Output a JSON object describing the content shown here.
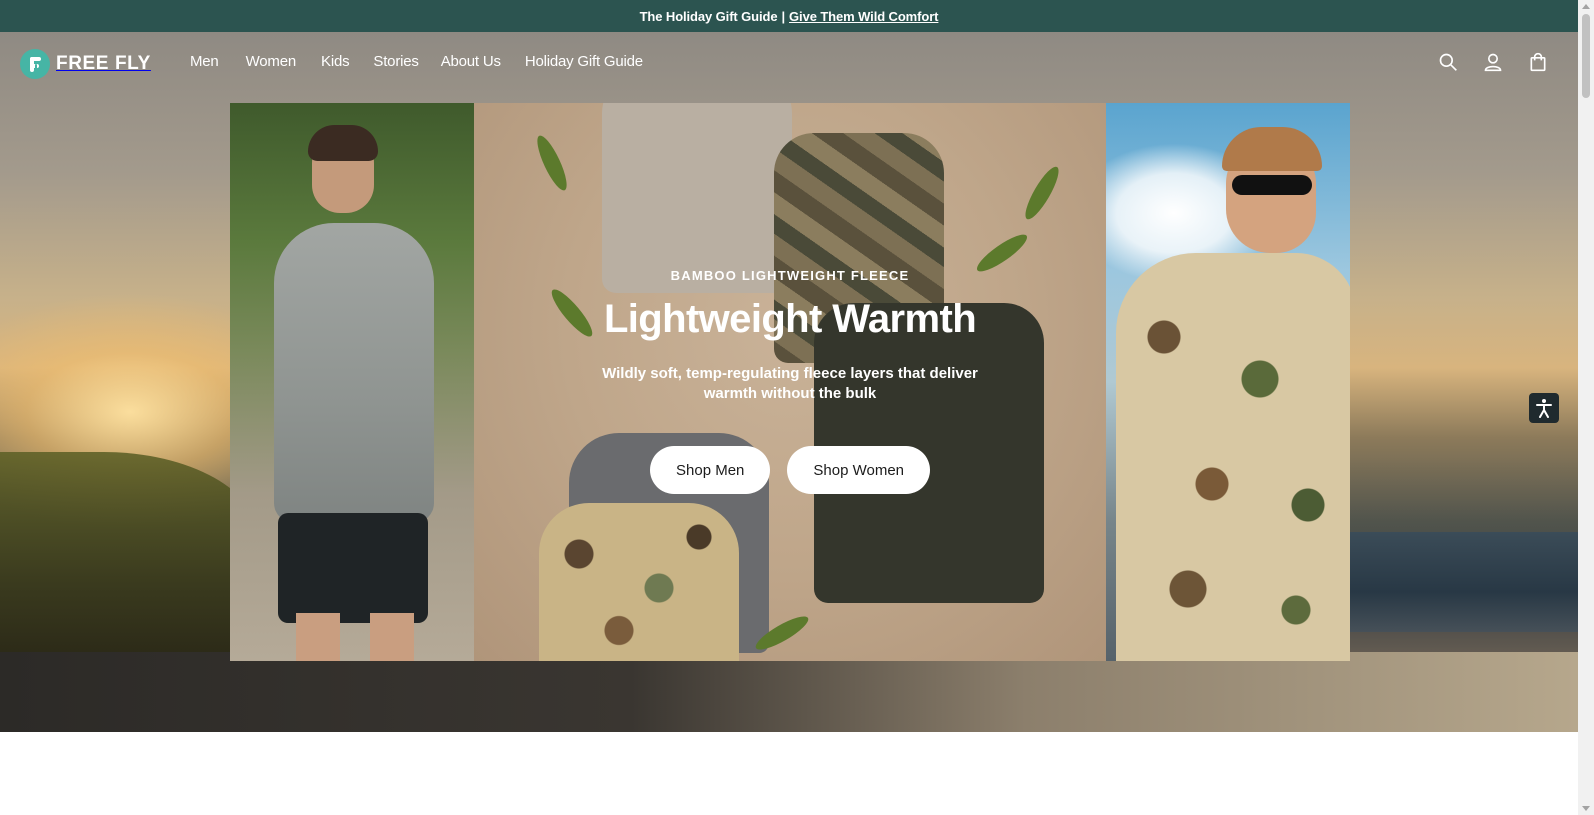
{
  "announcement": {
    "text": "The Holiday Gift Guide",
    "separator": "|",
    "link_text": "Give Them Wild Comfort"
  },
  "brand": {
    "name": "FREE FLY",
    "accent_color": "#46b5a5",
    "bar_color": "#2c5450"
  },
  "nav": {
    "items": [
      {
        "label": "Men"
      },
      {
        "label": "Women"
      },
      {
        "label": "Kids"
      },
      {
        "label": "Stories"
      },
      {
        "label": "About Us"
      },
      {
        "label": "Holiday Gift Guide"
      }
    ]
  },
  "header_icons": [
    "search-icon",
    "account-icon",
    "cart-icon"
  ],
  "hero": {
    "eyebrow": "BAMBOO LIGHTWEIGHT FLEECE",
    "headline": "Lightweight Warmth",
    "subtext": "Wildly soft, temp-regulating fleece layers that deliver warmth without the bulk",
    "cta_primary": "Shop Men",
    "cta_secondary": "Shop Women"
  },
  "accessibility": {
    "icon": "accessibility-icon"
  }
}
